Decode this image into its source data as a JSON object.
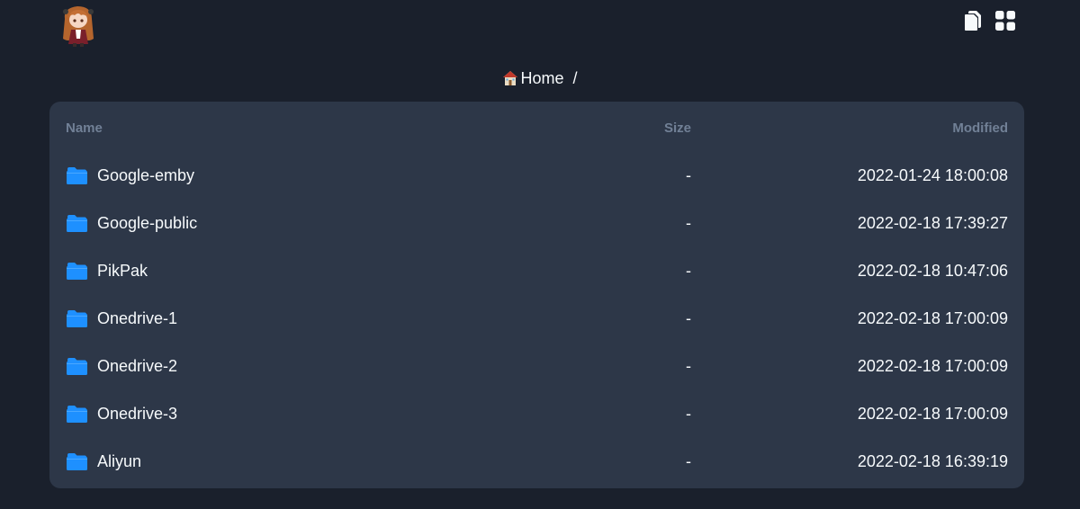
{
  "breadcrumb": {
    "home_label": "Home",
    "separator": "/"
  },
  "table": {
    "headers": {
      "name": "Name",
      "size": "Size",
      "modified": "Modified"
    },
    "rows": [
      {
        "name": "Google-emby",
        "size": "-",
        "modified": "2022-01-24 18:00:08",
        "icon": "folder-icon"
      },
      {
        "name": "Google-public",
        "size": "-",
        "modified": "2022-02-18 17:39:27",
        "icon": "folder-icon"
      },
      {
        "name": "PikPak",
        "size": "-",
        "modified": "2022-02-18 10:47:06",
        "icon": "folder-icon"
      },
      {
        "name": "Onedrive-1",
        "size": "-",
        "modified": "2022-02-18 17:00:09",
        "icon": "folder-icon"
      },
      {
        "name": "Onedrive-2",
        "size": "-",
        "modified": "2022-02-18 17:00:09",
        "icon": "folder-icon"
      },
      {
        "name": "Onedrive-3",
        "size": "-",
        "modified": "2022-02-18 17:00:09",
        "icon": "folder-icon"
      },
      {
        "name": "Aliyun",
        "size": "-",
        "modified": "2022-02-18 16:39:19",
        "icon": "folder-icon"
      }
    ]
  },
  "header": {
    "icons": [
      "avatar",
      "copy-icon",
      "grid-view-icon"
    ]
  },
  "colors": {
    "background": "#1a202c",
    "panel": "#2d3748",
    "header_text": "#718096",
    "folder": "#1e90ff",
    "text": "#f7fafc"
  }
}
